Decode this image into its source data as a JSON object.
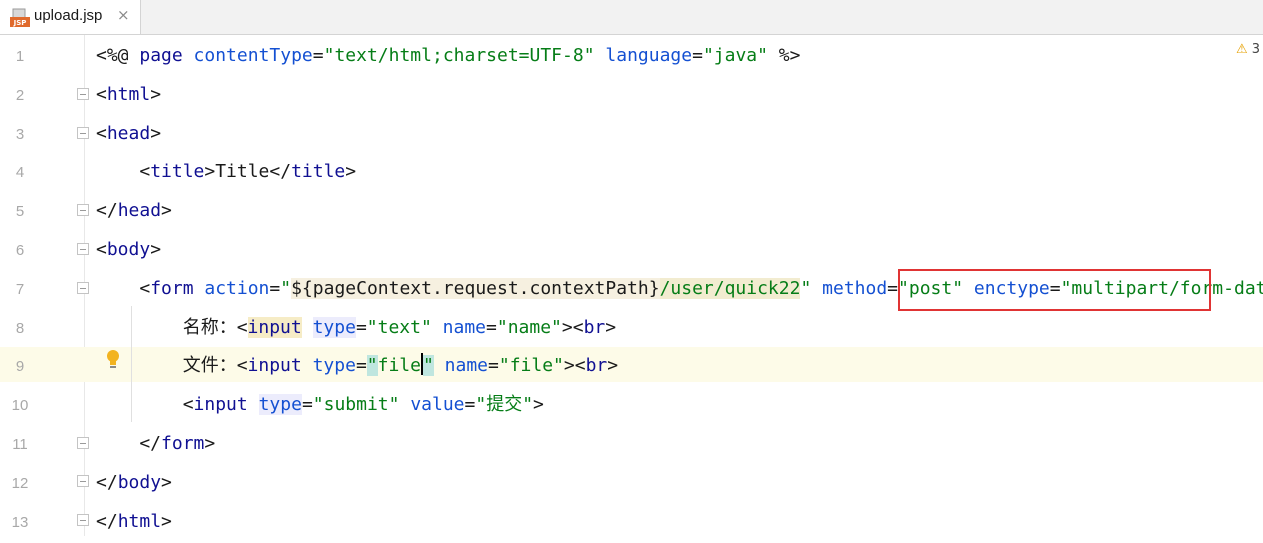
{
  "tab": {
    "file_name": "upload.jsp",
    "icon": "jsp-file-icon",
    "icon_badge": "JSP",
    "close_glyph": "×"
  },
  "inspection": {
    "icon": "warning-icon",
    "count": "3"
  },
  "lines": [
    {
      "number": "1",
      "tokens": [
        [
          "p",
          "<%@ "
        ],
        [
          "t",
          "page "
        ],
        [
          "a",
          "contentType"
        ],
        [
          "p",
          "="
        ],
        [
          "s",
          "\"text/html;charset=UTF-8\""
        ],
        [
          "p",
          " "
        ],
        [
          "a",
          "language"
        ],
        [
          "p",
          "="
        ],
        [
          "s",
          "\"java\""
        ],
        [
          "p",
          " %>"
        ]
      ]
    },
    {
      "number": "2",
      "tokens": [
        [
          "p",
          "<"
        ],
        [
          "t",
          "html"
        ],
        [
          "p",
          ">"
        ]
      ]
    },
    {
      "number": "3",
      "tokens": [
        [
          "p",
          "<"
        ],
        [
          "t",
          "head"
        ],
        [
          "p",
          ">"
        ]
      ]
    },
    {
      "number": "4",
      "tokens": [
        [
          "p",
          "    <"
        ],
        [
          "t",
          "title"
        ],
        [
          "p",
          ">Title</"
        ],
        [
          "t",
          "title"
        ],
        [
          "p",
          ">"
        ]
      ]
    },
    {
      "number": "5",
      "tokens": [
        [
          "p",
          "</"
        ],
        [
          "t",
          "head"
        ],
        [
          "p",
          ">"
        ]
      ]
    },
    {
      "number": "6",
      "tokens": [
        [
          "p",
          "<"
        ],
        [
          "t",
          "body"
        ],
        [
          "p",
          ">"
        ]
      ]
    },
    {
      "number": "7",
      "tokens": [
        [
          "p",
          "    <"
        ],
        [
          "t",
          "form "
        ],
        [
          "a",
          "action"
        ],
        [
          "p",
          "="
        ],
        [
          "s",
          "\""
        ],
        [
          "s-pc",
          "${pageContext.request.contextPath}"
        ],
        [
          "s-url",
          "/user/quick22"
        ],
        [
          "s",
          "\""
        ],
        [
          "p",
          " "
        ],
        [
          "a",
          "method"
        ],
        [
          "p",
          "="
        ],
        [
          "s",
          "\"post\""
        ],
        [
          "p",
          " "
        ],
        [
          "a",
          "enctype"
        ],
        [
          "p",
          "="
        ],
        [
          "s",
          "\"multipart/form-data\""
        ],
        [
          "p",
          ">"
        ]
      ]
    },
    {
      "number": "8",
      "tokens": [
        [
          "p",
          "        名称：<"
        ],
        [
          "t-hl",
          "input"
        ],
        [
          "p",
          " "
        ],
        [
          "a-hl",
          "type"
        ],
        [
          "p",
          "="
        ],
        [
          "s",
          "\"text\""
        ],
        [
          "p",
          " "
        ],
        [
          "a",
          "name"
        ],
        [
          "p",
          "="
        ],
        [
          "s",
          "\"name\""
        ],
        [
          "p",
          ">"
        ],
        [
          "p",
          "<"
        ],
        [
          "t",
          "br"
        ],
        [
          "p",
          ">"
        ]
      ]
    },
    {
      "number": "9",
      "tokens": [
        [
          "p",
          "        文件：<"
        ],
        [
          "t",
          "input"
        ],
        [
          "p",
          " "
        ],
        [
          "a",
          "type"
        ],
        [
          "p",
          "="
        ],
        [
          "s-file",
          "\""
        ],
        [
          "s",
          "file"
        ],
        [
          "cursor",
          ""
        ],
        [
          "s-file",
          "\""
        ],
        [
          "p",
          " "
        ],
        [
          "a",
          "name"
        ],
        [
          "p",
          "="
        ],
        [
          "s",
          "\"file\""
        ],
        [
          "p",
          ">"
        ],
        [
          "p",
          "<"
        ],
        [
          "t",
          "br"
        ],
        [
          "p",
          ">"
        ]
      ]
    },
    {
      "number": "10",
      "tokens": [
        [
          "p",
          "        <"
        ],
        [
          "t",
          "input "
        ],
        [
          "a-hl",
          "type"
        ],
        [
          "p",
          "="
        ],
        [
          "s",
          "\"submit\""
        ],
        [
          "p",
          " "
        ],
        [
          "a",
          "value"
        ],
        [
          "p",
          "="
        ],
        [
          "s",
          "\"提交\""
        ],
        [
          "p",
          ">"
        ]
      ]
    },
    {
      "number": "11",
      "tokens": [
        [
          "p",
          "    </"
        ],
        [
          "t",
          "form"
        ],
        [
          "p",
          ">"
        ]
      ]
    },
    {
      "number": "12",
      "tokens": [
        [
          "p",
          "</"
        ],
        [
          "t",
          "body"
        ],
        [
          "p",
          ">"
        ]
      ]
    },
    {
      "number": "13",
      "tokens": [
        [
          "p",
          "</"
        ],
        [
          "t",
          "html"
        ],
        [
          "p",
          ">"
        ]
      ]
    }
  ]
}
